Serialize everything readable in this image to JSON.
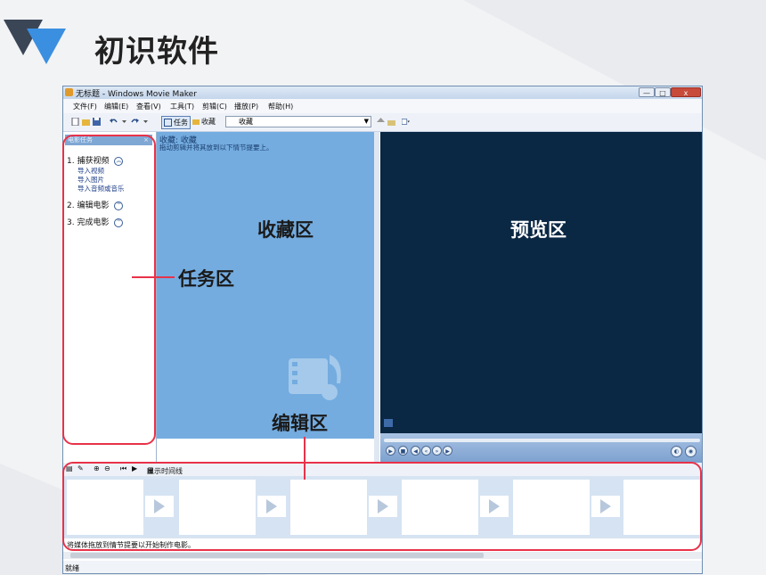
{
  "slide": {
    "title": "初识软件"
  },
  "window": {
    "title": "无标题 - Windows Movie Maker",
    "controls": {
      "minimize": "—",
      "maximize": "□",
      "close": "x"
    }
  },
  "menu": [
    "文件(F)",
    "编辑(E)",
    "查看(V)",
    "工具(T)",
    "剪辑(C)",
    "播放(P)",
    "帮助(H)"
  ],
  "toolbar": {
    "tasks_label": "任务",
    "collections_label": "收藏",
    "collection_select": "收藏"
  },
  "task_pane": {
    "header": "电影任务",
    "close": "×",
    "task1": "1. 捕获视频",
    "task1_links": [
      "导入视频",
      "导入图片",
      "导入音频或音乐"
    ],
    "task2": "2. 编辑电影",
    "task3": "3. 完成电影"
  },
  "collection_pane": {
    "heading": "收藏: 收藏",
    "hint": "拖动剪辑并将其放到以下情节提要上。"
  },
  "storyboard": {
    "show_timeline": "显示时间线",
    "hint": "将媒体拖放到情节提要以开始制作电影。"
  },
  "status": "就绪",
  "annotations": {
    "tasks_area": "任务区",
    "collection_area": "收藏区",
    "preview_area": "预览区",
    "edit_area": "编辑区"
  },
  "colors": {
    "highlight": "#e8324a",
    "collection_bg": "#74ace0",
    "preview_bg": "#0a2744"
  }
}
